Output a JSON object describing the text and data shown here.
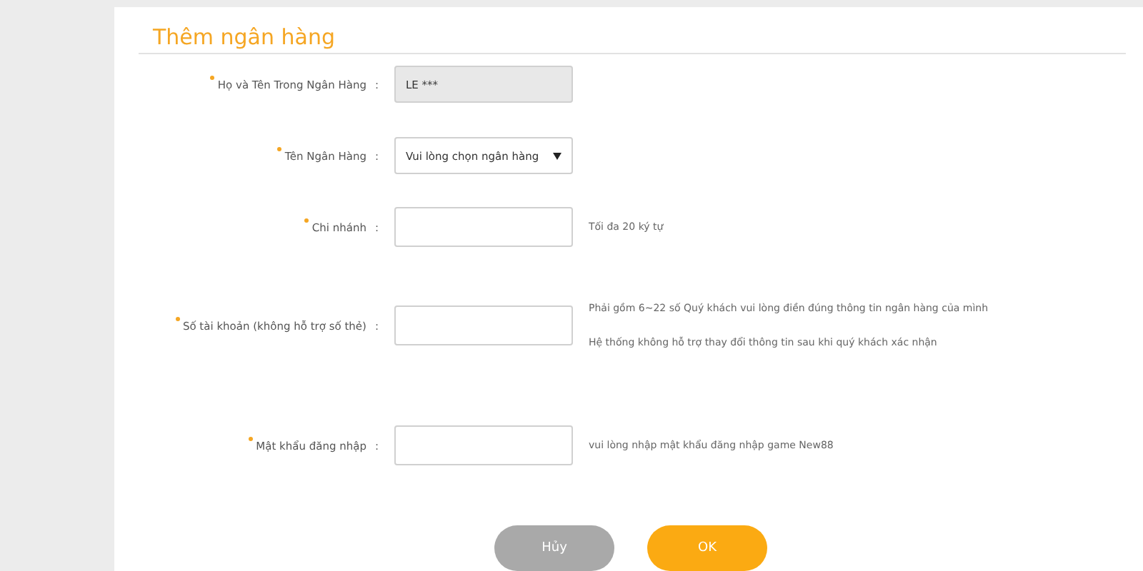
{
  "dialog": {
    "title": "Thêm ngân hàng"
  },
  "fields": [
    {
      "label": "Họ và Tên Trong Ngân Hàng",
      "required": true,
      "kind": "readonly",
      "value": "LE ***"
    },
    {
      "label": "Tên Ngân Hàng",
      "required": true,
      "kind": "select",
      "value": "Vui lòng chọn ngân hàng"
    },
    {
      "label": "Chi nhánh",
      "required": true,
      "kind": "text",
      "hints": [
        "Tối đa 20 ký tự"
      ]
    },
    {
      "label": "Số tài khoản (không hỗ trợ số thẻ)",
      "required": true,
      "kind": "text",
      "hints": [
        "Phải gồm 6~22 số Quý khách vui lòng điền đúng thông tin ngân hàng của mình",
        "Hệ thống không hỗ trợ thay đổi thông tin sau khi quý khách xác nhận"
      ]
    },
    {
      "label": "Mật khẩu đăng nhập",
      "required": true,
      "kind": "password",
      "hints": [
        "vui lòng nhập mật khẩu đăng nhập game New88"
      ]
    }
  ],
  "separator": ":",
  "buttons": [
    {
      "label": "Hủy",
      "kind": "cancel"
    },
    {
      "label": "OK",
      "kind": "confirm"
    }
  ]
}
